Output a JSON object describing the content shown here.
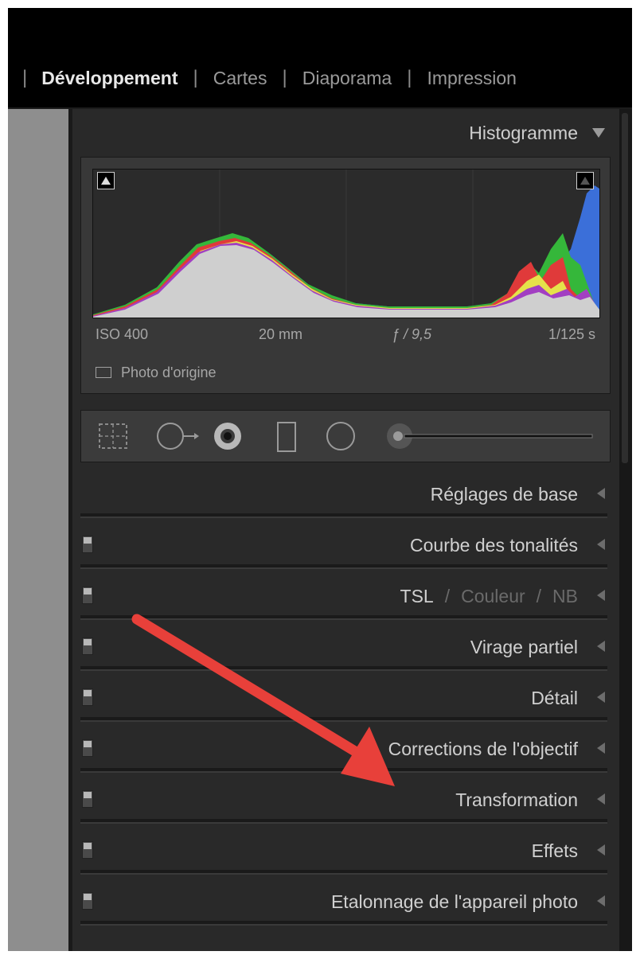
{
  "modules": {
    "items": [
      "Développement",
      "Cartes",
      "Diaporama",
      "Impression"
    ],
    "active": "Développement"
  },
  "histogram": {
    "title": "Histogramme",
    "iso": "ISO 400",
    "focal": "20 mm",
    "aperture": "ƒ / 9,5",
    "shutter": "1/125 s",
    "original_label": "Photo d'origine"
  },
  "sections": {
    "basic": "Réglages de base",
    "tone_curve": "Courbe des tonalités",
    "hsl": {
      "tsl": "TSL",
      "sep1": "/",
      "couleur": "Couleur",
      "sep2": "/",
      "nb": "NB"
    },
    "split_toning": "Virage partiel",
    "detail": "Détail",
    "lens": "Corrections de l'objectif",
    "transform": "Transformation",
    "effects": "Effets",
    "calibration": "Etalonnage de l'appareil photo"
  },
  "icons": {
    "collapse": "triangle-down-icon",
    "expand": "triangle-left-icon",
    "clip_shadows": "clip-warning-icon",
    "crop": "crop-tool-icon",
    "spot": "spot-removal-icon",
    "redeye": "red-eye-icon",
    "gradient": "graduated-filter-icon",
    "radial": "radial-filter-icon",
    "brush": "adjustment-brush-icon"
  },
  "colors": {
    "annotation_arrow": "#e8403a"
  }
}
